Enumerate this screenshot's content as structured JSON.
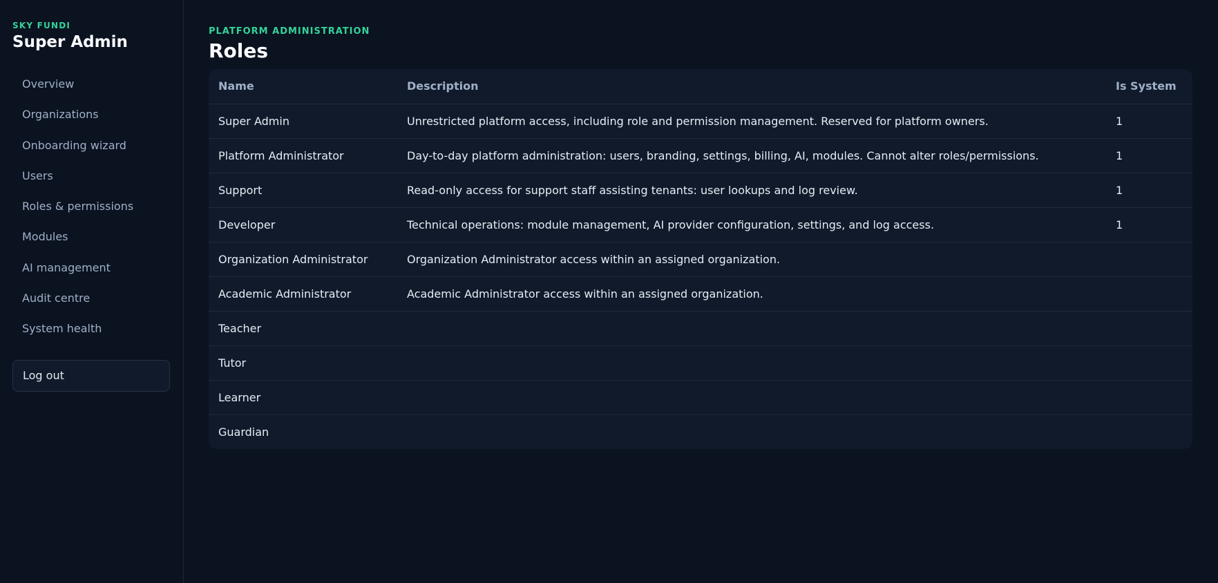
{
  "sidebar": {
    "brand_kicker": "SKY FUNDI",
    "brand_title": "Super Admin",
    "items": [
      {
        "label": "Overview"
      },
      {
        "label": "Organizations"
      },
      {
        "label": "Onboarding wizard"
      },
      {
        "label": "Users"
      },
      {
        "label": "Roles & permissions"
      },
      {
        "label": "Modules"
      },
      {
        "label": "AI management"
      },
      {
        "label": "Audit centre"
      },
      {
        "label": "System health"
      }
    ],
    "logout_label": "Log out"
  },
  "main": {
    "kicker": "PLATFORM ADMINISTRATION",
    "title": "Roles",
    "table": {
      "columns": [
        "Name",
        "Description",
        "Is System"
      ],
      "rows": [
        {
          "name": "Super Admin",
          "description": "Unrestricted platform access, including role and permission management. Reserved for platform owners.",
          "is_system": "1"
        },
        {
          "name": "Platform Administrator",
          "description": "Day-to-day platform administration: users, branding, settings, billing, AI, modules. Cannot alter roles/permissions.",
          "is_system": "1"
        },
        {
          "name": "Support",
          "description": "Read-only access for support staff assisting tenants: user lookups and log review.",
          "is_system": "1"
        },
        {
          "name": "Developer",
          "description": "Technical operations: module management, AI provider configuration, settings, and log access.",
          "is_system": "1"
        },
        {
          "name": "Organization Administrator",
          "description": "Organization Administrator access within an assigned organization.",
          "is_system": ""
        },
        {
          "name": "Academic Administrator",
          "description": "Academic Administrator access within an assigned organization.",
          "is_system": ""
        },
        {
          "name": "Teacher",
          "description": "",
          "is_system": ""
        },
        {
          "name": "Tutor",
          "description": "",
          "is_system": ""
        },
        {
          "name": "Learner",
          "description": "",
          "is_system": ""
        },
        {
          "name": "Guardian",
          "description": "",
          "is_system": ""
        }
      ]
    }
  },
  "colors": {
    "background": "#0b1220",
    "card": "#111a2b",
    "accent": "#34d399",
    "muted_text": "#9fb0c8",
    "text": "#e6ecf5"
  }
}
